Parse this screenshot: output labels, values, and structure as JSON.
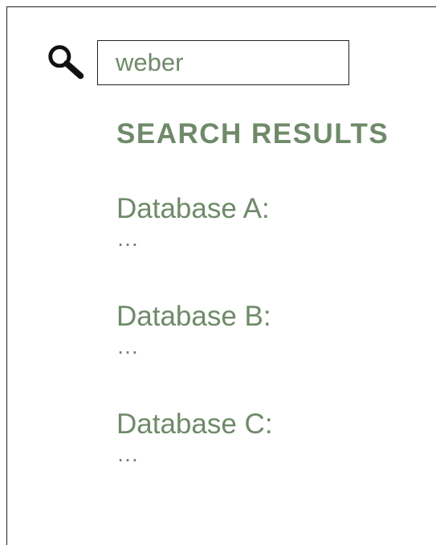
{
  "search": {
    "icon": "search-icon",
    "value": "weber"
  },
  "results": {
    "title": "SEARCH RESULTS",
    "items": [
      {
        "label": "Database A:",
        "content": "…"
      },
      {
        "label": "Database B:",
        "content": "…"
      },
      {
        "label": "Database C:",
        "content": "…"
      }
    ]
  },
  "colors": {
    "text": "#6f8a69",
    "border": "#222222",
    "background": "#ffffff"
  }
}
